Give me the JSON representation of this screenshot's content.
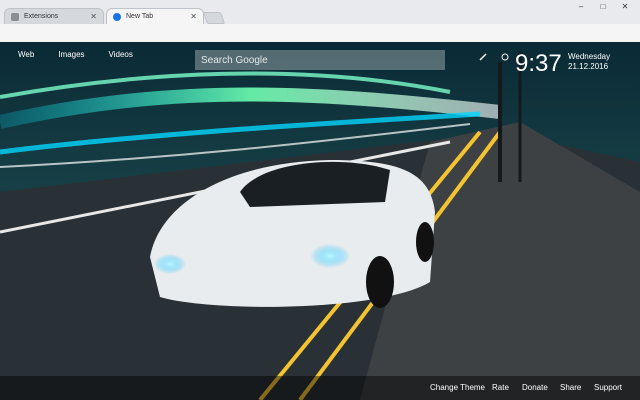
{
  "browser": {
    "tabs": [
      {
        "label": "Extensions",
        "active": false,
        "icon": "puzzle-icon"
      },
      {
        "label": "New Tab",
        "active": true,
        "icon": "new-tab-icon"
      }
    ],
    "window_controls": [
      "minimize-icon",
      "maximize-icon",
      "close-icon"
    ],
    "address": "",
    "accent": "#1a73e8"
  },
  "page": {
    "links": [
      "Web",
      "Images",
      "Videos"
    ],
    "search_placeholder": "Search Google",
    "clock": "9:37",
    "day": "Wednesday",
    "date": "21.12.2016",
    "footer": [
      "Change Theme",
      "Rate",
      "Donate",
      "Share",
      "Support"
    ]
  }
}
